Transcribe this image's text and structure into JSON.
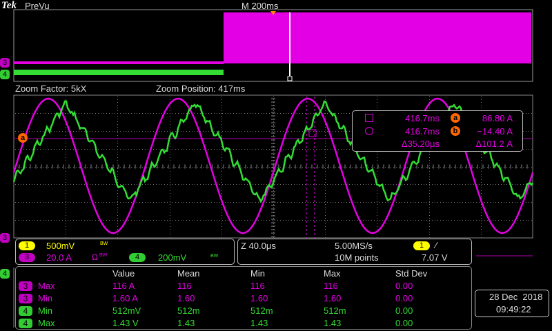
{
  "brand": "Tek",
  "mode": "PreVu",
  "timebase": "M 200ms",
  "zoom": {
    "factor_label": "Zoom Factor: 5kX",
    "position_label": "Zoom Position: 417ms"
  },
  "markers": {
    "ch3": "3",
    "ch4": "4",
    "cursor_a": "a"
  },
  "cursor_readout": {
    "row1": {
      "time": "416.7ms",
      "chip": "a",
      "value": "86.80 A"
    },
    "row2": {
      "time": "416.7ms",
      "chip": "b",
      "value": "−14.40 A"
    },
    "row3": {
      "dtime": "Δ35.20μs",
      "dvalue": "Δ101.2 A"
    }
  },
  "channels": {
    "ch1": {
      "num": "1",
      "scale": "500mV",
      "bw": "BW"
    },
    "ch3": {
      "num": "3",
      "scale": "20.0 A",
      "coupling": "Ω",
      "bw": "BW"
    },
    "ch4": {
      "num": "4",
      "scale": "200mV",
      "bw": "BW"
    }
  },
  "acq": {
    "zoom_scale": "Z 40.0μs",
    "rate": "5.00MS/s",
    "points": "10M points"
  },
  "trigger": {
    "channel": "1",
    "slope": "∕",
    "level": "7.07 V"
  },
  "measurements": {
    "headers": [
      "Value",
      "Mean",
      "Min",
      "Max",
      "Std Dev"
    ],
    "rows": [
      {
        "ch": "3",
        "name": "Max",
        "value": "116 A",
        "mean": "116",
        "min": "116",
        "max": "116",
        "std": "0.00",
        "color": "mag"
      },
      {
        "ch": "3",
        "name": "Min",
        "value": "1.60 A",
        "mean": "1.60",
        "min": "1.60",
        "max": "1.60",
        "std": "0.00",
        "color": "mag"
      },
      {
        "ch": "4",
        "name": "Min",
        "value": "512mV",
        "mean": "512m",
        "min": "512m",
        "max": "512m",
        "std": "0.00",
        "color": "green"
      },
      {
        "ch": "4",
        "name": "Max",
        "value": "1.43 V",
        "mean": "1.43",
        "min": "1.43",
        "max": "1.43",
        "std": "0.00",
        "color": "green"
      }
    ]
  },
  "datetime": {
    "date": "28 Dec  2018",
    "time": "09:49:22"
  },
  "colors": {
    "ch3": "#e400e4",
    "ch4": "#33dd33",
    "ch1": "#ffff00",
    "cursor": "#ff6600"
  }
}
